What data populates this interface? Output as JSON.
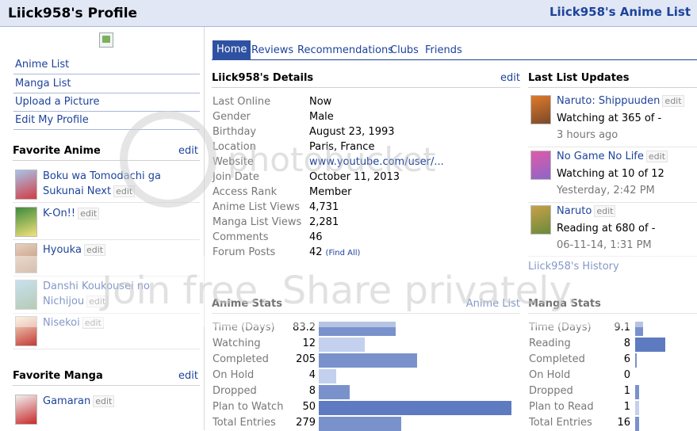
{
  "header": {
    "title": "Liick958's Profile",
    "list_link": "Liick958's Anime List"
  },
  "sidebar": {
    "links": [
      "Anime List",
      "Manga List",
      "Upload a Picture",
      "Edit My Profile"
    ],
    "fav_anime_title": "Favorite Anime",
    "edit": "edit",
    "fav_anime": [
      {
        "name": "Boku wa Tomodachi ga Sukunai Next",
        "c1": "#a7c4e8",
        "c2": "#d33c44"
      },
      {
        "name": "K-On!!",
        "c1": "#3d8a3d",
        "c2": "#f2e27a"
      },
      {
        "name": "Hyouka",
        "c1": "#e8d0c0",
        "c2": "#b58b6b"
      },
      {
        "name": "Danshi Koukousei no Nichijou",
        "c1": "#9cc7e0",
        "c2": "#7aa17a"
      },
      {
        "name": "Nisekoi",
        "c1": "#f6e8c8",
        "c2": "#c43a3a"
      }
    ],
    "fav_manga_title": "Favorite Manga",
    "fav_manga": [
      {
        "name": "Gamaran",
        "c1": "#f0f0f0",
        "c2": "#c82a2a"
      }
    ]
  },
  "tabs": [
    "Home",
    "Reviews",
    "Recommendations",
    "Clubs",
    "Friends"
  ],
  "details": {
    "title": "Liick958's Details",
    "edit": "edit",
    "rows": [
      {
        "label": "Last Online",
        "value": "Now"
      },
      {
        "label": "Gender",
        "value": "Male"
      },
      {
        "label": "Birthday",
        "value": "August 23, 1993"
      },
      {
        "label": "Location",
        "value": "Paris, France"
      },
      {
        "label": "Website",
        "value": "www.youtube.com/user/..."
      },
      {
        "label": "Join Date",
        "value": "October 11, 2013"
      },
      {
        "label": "Access Rank",
        "value": "Member"
      },
      {
        "label": "Anime List Views",
        "value": "4,731"
      },
      {
        "label": "Manga List Views",
        "value": "2,281"
      },
      {
        "label": "Comments",
        "value": "46"
      },
      {
        "label": "Forum Posts",
        "value": "42"
      }
    ],
    "find_all": "(Find All)"
  },
  "updates": {
    "title": "Last List Updates",
    "items": [
      {
        "name": "Naruto: Shippuuden",
        "status": "Watching at 365 of -",
        "time": "3 hours ago",
        "c1": "#e07a2a",
        "c2": "#7a4a2a"
      },
      {
        "name": "No Game No Life",
        "status": "Watching at 10 of 12",
        "time": "Yesterday, 2:42 PM",
        "c1": "#e05aa8",
        "c2": "#8c66c8"
      },
      {
        "name": "Naruto",
        "status": "Reading at 680 of -",
        "time": "06-11-14, 1:31 PM",
        "c1": "#c8a04a",
        "c2": "#6a8a3a"
      }
    ],
    "history": "Liick958's History"
  },
  "anime_stats": {
    "title": "Anime Stats",
    "link": "Anime List",
    "rows": [
      {
        "label": "Time (Days)",
        "value": "83.2",
        "fraction": 0.4
      },
      {
        "label": "Watching",
        "value": "12",
        "fraction": 0.24
      },
      {
        "label": "Completed",
        "value": "205",
        "fraction": 0.51
      },
      {
        "label": "On Hold",
        "value": "4",
        "fraction": 0.09
      },
      {
        "label": "Dropped",
        "value": "8",
        "fraction": 0.16
      },
      {
        "label": "Plan to Watch",
        "value": "50",
        "fraction": 1.0
      },
      {
        "label": "Total Entries",
        "value": "279",
        "fraction": 0.43
      }
    ]
  },
  "manga_stats": {
    "title": "Manga Stats",
    "rows": [
      {
        "label": "Time (Days)",
        "value": "9.1",
        "fraction": 0.26
      },
      {
        "label": "Reading",
        "value": "8",
        "fraction": 1.0
      },
      {
        "label": "Completed",
        "value": "6",
        "fraction": 0.05
      },
      {
        "label": "On Hold",
        "value": "0",
        "fraction": 0.0
      },
      {
        "label": "Dropped",
        "value": "1",
        "fraction": 0.12
      },
      {
        "label": "Plan to Read",
        "value": "1",
        "fraction": 0.12
      },
      {
        "label": "Total Entries",
        "value": "16",
        "fraction": 0.12
      }
    ]
  },
  "watermark": {
    "line1": "photobucket",
    "line2": "Join free. Share privately."
  },
  "colors": {
    "link": "#1d439b",
    "tab_active": "#2e51a2",
    "bar_dark": "#5e7ac0",
    "bar_mid": "#7a92cc",
    "bar_light": "#c3d0ee"
  }
}
